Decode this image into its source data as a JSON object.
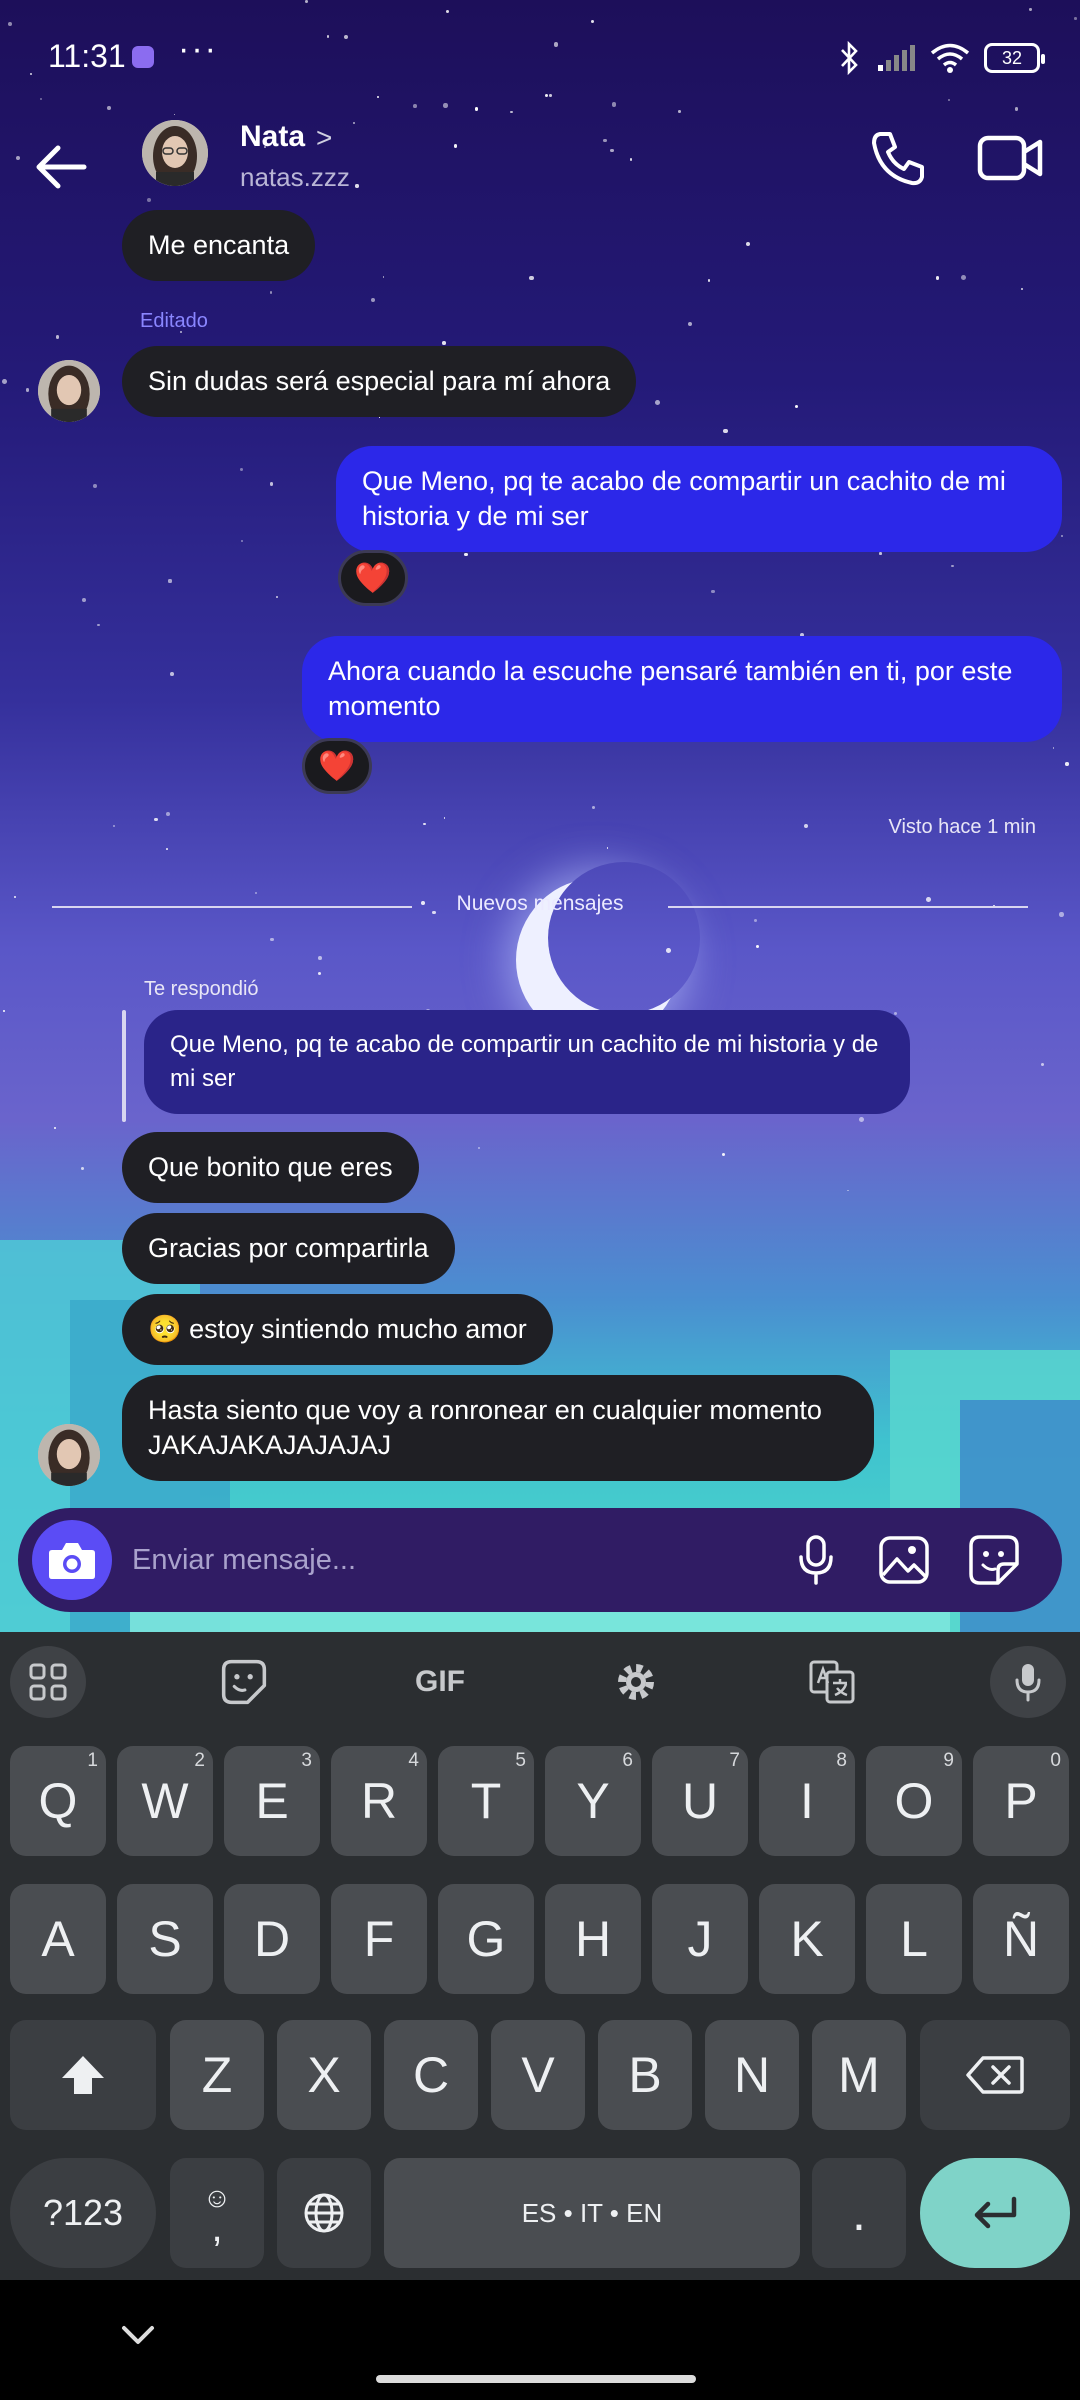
{
  "status_bar": {
    "time": "11:31",
    "more": "···",
    "battery": "32"
  },
  "header": {
    "name": "Nata",
    "chevron": ">",
    "username": "natas.zzz"
  },
  "messages": {
    "m1": "Me encanta",
    "edited": "Editado",
    "m2": "Sin dudas será especial para mí ahora",
    "m3": "Que Meno, pq te acabo de compartir un cachito de mi historia y de mi ser",
    "m4": "Ahora cuando la escuche pensaré también en ti, por este momento",
    "seen": "Visto hace 1 min",
    "new_messages": "Nuevos mensajes",
    "replied": "Te respondió",
    "quoted": "Que Meno, pq te acabo de compartir un cachito de mi historia y de mi ser",
    "m5": "Que bonito que eres",
    "m6": "Gracias por compartirla",
    "m7": "🥺 estoy sintiendo mucho amor",
    "m8": "Hasta siento que voy a ronronear en cualquier momento JAKAJAKAJAJAJAJ",
    "reaction": "❤️"
  },
  "composer": {
    "placeholder": "Enviar mensaje..."
  },
  "keyboard": {
    "gif": "GIF",
    "row1": [
      "Q",
      "W",
      "E",
      "R",
      "T",
      "Y",
      "U",
      "I",
      "O",
      "P"
    ],
    "row1_hints": [
      "1",
      "2",
      "3",
      "4",
      "5",
      "6",
      "7",
      "8",
      "9",
      "0"
    ],
    "row2": [
      "A",
      "S",
      "D",
      "F",
      "G",
      "H",
      "J",
      "K",
      "L",
      "Ñ"
    ],
    "row3": [
      "Z",
      "X",
      "C",
      "V",
      "B",
      "N",
      "M"
    ],
    "symbols": "?123",
    "emoji": "☺",
    "comma": ",",
    "space": "ES • IT • EN",
    "period": "."
  },
  "colors": {
    "outgoing": "#2c28e9",
    "incoming": "#1f1f24",
    "accent": "#5b4cf5",
    "enter": "#7fd3c8"
  }
}
